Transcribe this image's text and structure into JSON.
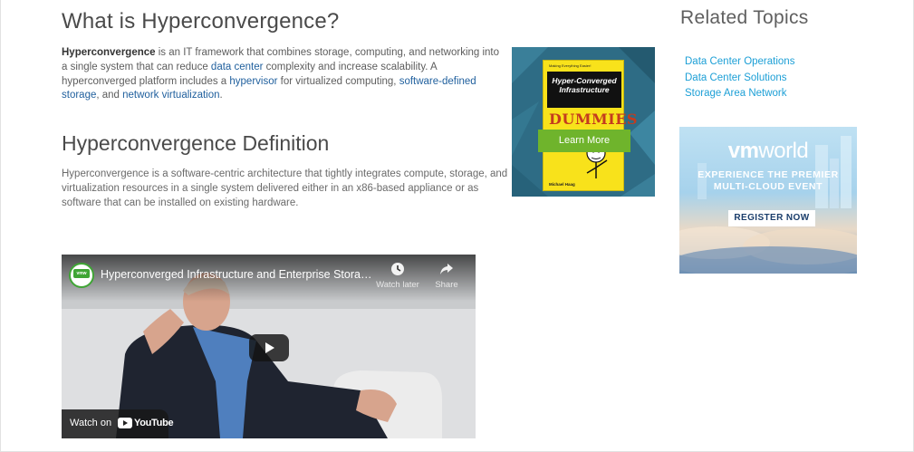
{
  "article": {
    "heading": "What is Hyperconvergence?",
    "intro": {
      "term": "Hyperconvergence",
      "t1": " is an IT framework that combines storage, computing, and networking into a single system that can reduce ",
      "link1": "data center",
      "t2": " complexity and increase scalability. A hyperconverged platform includes a ",
      "link2": "hypervisor",
      "t3": " for virtualized computing, ",
      "link3": "software-defined storage",
      "t4": ", and ",
      "link4": "network virtualization",
      "t5": "."
    },
    "definition_heading": "Hyperconvergence Definition",
    "definition_text": "Hyperconvergence is a software-centric architecture that tightly integrates compute, storage, and virtualization resources in a single system delivered either in an x86-based appliance or as software that can be installed on existing hardware."
  },
  "book_promo": {
    "cover_tagline": "Making Everything Easier!",
    "cover_title": "Hyper-Converged Infrastructure",
    "cover_brand": "DUMMIES",
    "cover_author": "Michael Haag",
    "button_label": "Learn More"
  },
  "sidebar": {
    "title": "Related Topics",
    "links": [
      "Data Center Operations",
      "Data Center Solutions",
      "Storage Area Network"
    ]
  },
  "banner": {
    "logo_bold": "vm",
    "logo_regular": "world",
    "line1": "EXPERIENCE THE PREMIER",
    "line2": "MULTI-CLOUD EVENT",
    "button_label": "REGISTER NOW"
  },
  "video": {
    "channel_logo_text": "vmw",
    "title": "Hyperconverged Infrastructure and Enterprise Storag...",
    "watch_later_label": "Watch later",
    "share_label": "Share",
    "watch_on_label": "Watch on",
    "youtube_label": "YouTube"
  },
  "colors": {
    "link": "#1f5f9d",
    "sidebar_link": "#1c9fd6",
    "learn_more": "#6fb42c",
    "book_cover": "#f8e21b"
  }
}
